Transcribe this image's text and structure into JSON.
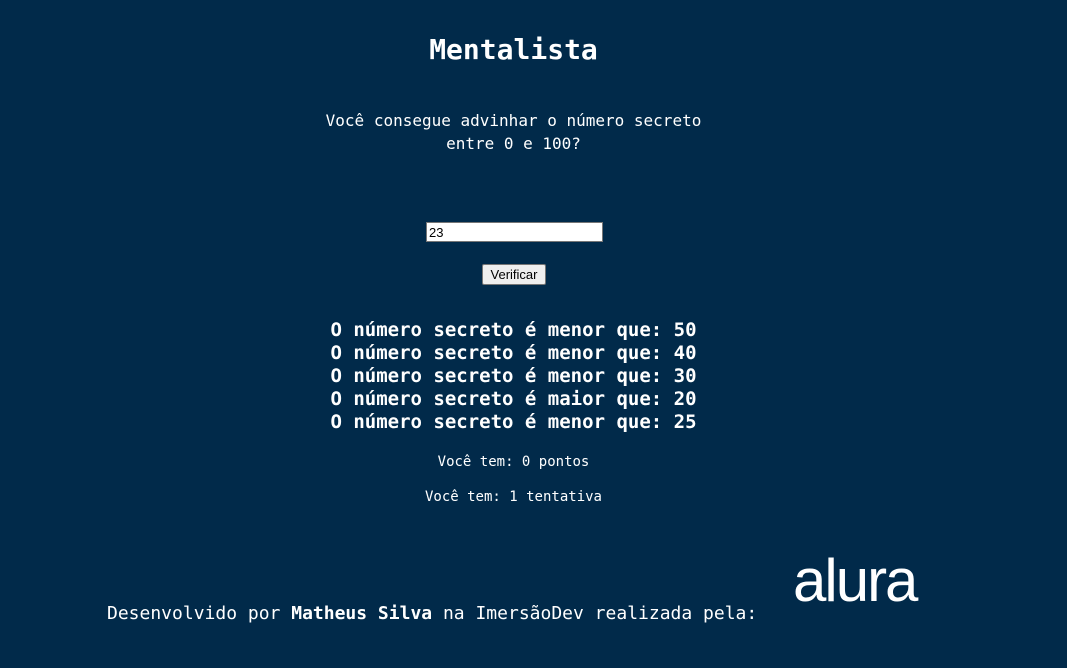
{
  "page": {
    "title": "Mentalista",
    "question_line1": "Você consegue advinhar o número secreto",
    "question_line2": "entre 0 e 100?"
  },
  "form": {
    "input_value": "23",
    "verify_label": "Verificar"
  },
  "hints": [
    "O número secreto é menor que: 50",
    "O número secreto é menor que: 40",
    "O número secreto é menor que: 30",
    "O número secreto é maior que: 20",
    "O número secreto é menor que: 25"
  ],
  "stats": {
    "points": "Você tem: 0 pontos",
    "attempts": "Você tem: 1 tentativa"
  },
  "footer": {
    "prefix": "Desenvolvido por ",
    "author": "Matheus Silva",
    "suffix": " na ImersãoDev realizada pela:",
    "logo_text": "alura",
    "logo_icon": "alura-logo"
  },
  "colors": {
    "background": "#012A4A",
    "text": "#ffffff"
  }
}
